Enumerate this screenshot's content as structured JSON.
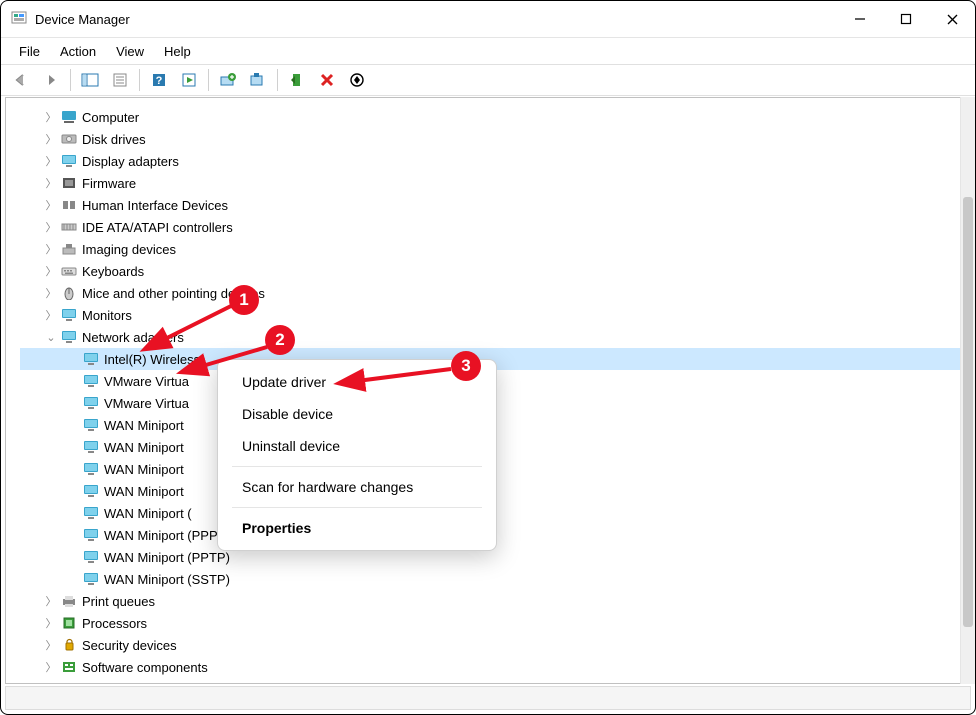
{
  "window": {
    "title": "Device Manager"
  },
  "menus": {
    "file": "File",
    "action": "Action",
    "view": "View",
    "help": "Help"
  },
  "tree": {
    "items": [
      {
        "label": "Computer",
        "icon": "computer-icon"
      },
      {
        "label": "Disk drives",
        "icon": "disk-icon"
      },
      {
        "label": "Display adapters",
        "icon": "display-icon"
      },
      {
        "label": "Firmware",
        "icon": "firmware-icon"
      },
      {
        "label": "Human Interface Devices",
        "icon": "hid-icon"
      },
      {
        "label": "IDE ATA/ATAPI controllers",
        "icon": "ide-icon"
      },
      {
        "label": "Imaging devices",
        "icon": "imaging-icon"
      },
      {
        "label": "Keyboards",
        "icon": "keyboard-icon"
      },
      {
        "label": "Mice and other pointing devices",
        "icon": "mouse-icon"
      },
      {
        "label": "Monitors",
        "icon": "monitor-icon"
      }
    ],
    "network_label": "Network adapters",
    "network_children": [
      {
        "label": "Intel(R) Wireless",
        "selected": true
      },
      {
        "label": "VMware Virtua"
      },
      {
        "label": "VMware Virtua"
      },
      {
        "label": "WAN Miniport"
      },
      {
        "label": "WAN Miniport"
      },
      {
        "label": "WAN Miniport"
      },
      {
        "label": "WAN Miniport"
      },
      {
        "label": "WAN Miniport ("
      },
      {
        "label": "WAN Miniport (PPPOE)"
      },
      {
        "label": "WAN Miniport (PPTP)"
      },
      {
        "label": "WAN Miniport (SSTP)"
      }
    ],
    "after": [
      {
        "label": "Print queues",
        "icon": "print-icon"
      },
      {
        "label": "Processors",
        "icon": "cpu-icon"
      },
      {
        "label": "Security devices",
        "icon": "security-icon"
      },
      {
        "label": "Software components",
        "icon": "software-icon"
      }
    ]
  },
  "context_menu": {
    "update": "Update driver",
    "disable": "Disable device",
    "uninstall": "Uninstall device",
    "scan": "Scan for hardware changes",
    "properties": "Properties"
  },
  "annotations": {
    "b1": "1",
    "b2": "2",
    "b3": "3"
  }
}
